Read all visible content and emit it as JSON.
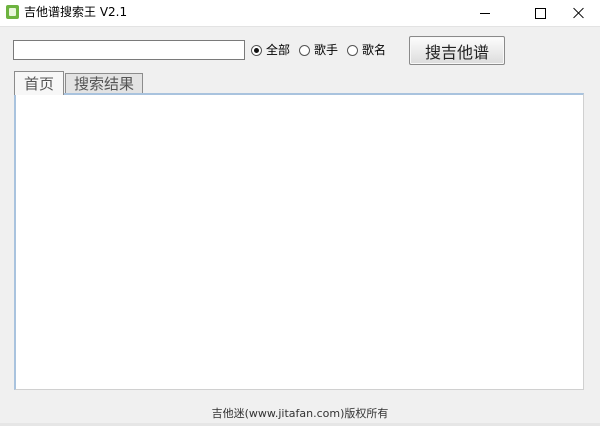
{
  "window": {
    "title": "吉他谱搜索王 V2.1",
    "icon": "app-guitar-icon",
    "controls": {
      "minimize_icon": "minimize-icon",
      "maximize_icon": "maximize-icon",
      "close_icon": "close-icon"
    }
  },
  "search": {
    "input_value": "",
    "options": [
      {
        "label": "全部",
        "checked": true
      },
      {
        "label": "歌手",
        "checked": false
      },
      {
        "label": "歌名",
        "checked": false
      }
    ],
    "button_label": "搜吉他谱"
  },
  "tabs": [
    {
      "label": "首页",
      "active": true
    },
    {
      "label": "搜索结果",
      "active": false
    }
  ],
  "footer": {
    "text": "吉他迷(www.jitafan.com)版权所有"
  },
  "colors": {
    "window_bg": "#f0f0f0",
    "panel_border": "#a9c3de",
    "panel_bg": "#ffffff"
  }
}
